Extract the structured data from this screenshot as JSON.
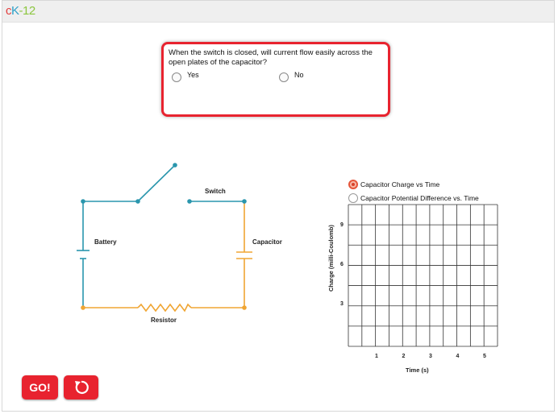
{
  "header": {
    "logo": {
      "c": "c",
      "k": "K",
      "num": "-12"
    }
  },
  "question": {
    "text": "When the switch is closed, will current flow easily across the open plates of the capacitor?",
    "options": [
      "Yes",
      "No"
    ]
  },
  "circuit": {
    "labels": {
      "switch": "Switch",
      "battery": "Battery",
      "capacitor": "Capacitor",
      "resistor": "Resistor"
    },
    "colors": {
      "teal": "#2a96ad",
      "orange": "#f0a533"
    }
  },
  "graph": {
    "options": [
      {
        "label": "Capacitor Charge vs Time",
        "selected": true
      },
      {
        "label": "Capacitor Potential Difference vs. Time",
        "selected": false
      }
    ],
    "ylabel": "Charge (milli-Coulomb)",
    "xlabel": "Time (s)",
    "yticks": [
      "9",
      "6",
      "3"
    ],
    "xticks": [
      "1",
      "2",
      "3",
      "4",
      "5"
    ]
  },
  "controls": {
    "go_label": "GO!"
  },
  "colors": {
    "accent": "#e8232f"
  }
}
